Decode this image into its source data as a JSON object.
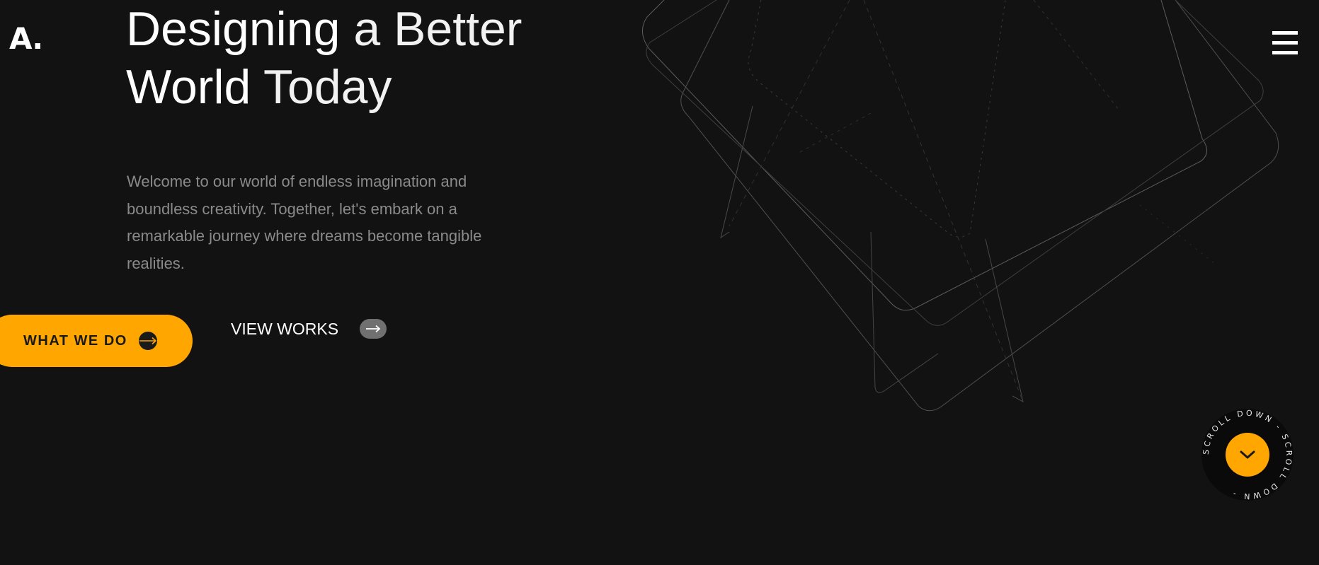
{
  "brand": {
    "logo_text": "A."
  },
  "header": {
    "menu_icon": "hamburger-menu-icon"
  },
  "hero": {
    "title_line1_bold": "Designing",
    "title_line1_light": " a Better",
    "title_line2_bold": "World",
    "title_line2_light": " Today",
    "description": "Welcome to our world of endless imagination and boundless creativity. Together, let's embark on a remarkable journey where dreams become tangible realities."
  },
  "actions": {
    "primary_label": "WHAT WE DO",
    "primary_icon": "arrow-right-icon",
    "secondary_label": "VIEW WORKS",
    "secondary_icon": "arrow-right-icon"
  },
  "scroll": {
    "circular_text": "SCROLL DOWN - SCROLL DOWN - ",
    "icon": "chevron-down-icon"
  },
  "colors": {
    "background": "#121212",
    "accent": "#ffa600",
    "text_primary": "#ffffff",
    "text_muted": "#8a8a8a"
  }
}
